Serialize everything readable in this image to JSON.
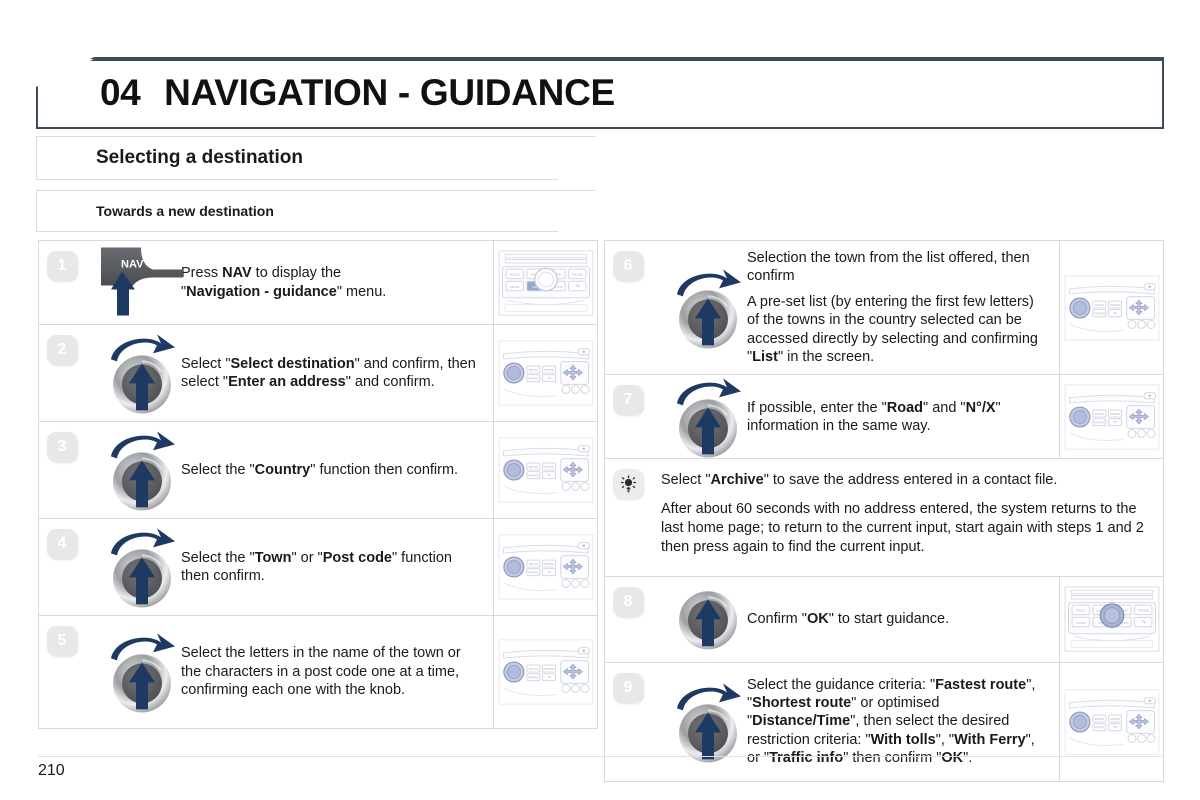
{
  "header": {
    "chapter_number": "04",
    "chapter_title": "NAVIGATION - GUIDANCE"
  },
  "section_title": "Selecting a destination",
  "subsection_title": "Towards a new destination",
  "page_number": "210",
  "colors": {
    "header_border": "#3c4a5a",
    "arrow_navy": "#1e3a63",
    "badge_grey": "#e8e8ea",
    "highlight_blue": "#9aa8cf",
    "knob_dark": "#5a5c5f"
  },
  "head_unit_buttons": {
    "top_row": [
      "RADIO",
      "MUSIC",
      "SETUP",
      "PHONE"
    ],
    "bottom_row": [
      "MODE",
      "NAV",
      "TRAFFIC"
    ],
    "side_labels": [
      "SETUP",
      "PHONE",
      "TRAFFIC"
    ]
  },
  "steps_left": [
    {
      "number": "1",
      "icon": "nav-button-press-icon",
      "screenshot": "head-unit-nav-highlighted",
      "text_html": "Press <b>NAV</b> to display the<br>\"<b>Navigation - guidance</b>\" menu."
    },
    {
      "number": "2",
      "icon": "rotary-knob-turn-press-icon",
      "screenshot": "head-unit-wide-knob",
      "text_html": "Select \"<b>Select destination</b>\" and confirm, then select \"<b>Enter an address</b>\" and confirm."
    },
    {
      "number": "3",
      "icon": "rotary-knob-turn-press-icon",
      "screenshot": "head-unit-wide-knob",
      "text_html": "Select the \"<b>Country</b>\" function then confirm."
    },
    {
      "number": "4",
      "icon": "rotary-knob-turn-press-icon",
      "screenshot": "head-unit-wide-knob",
      "text_html": "Select the \"<b>Town</b>\" or \"<b>Post code</b>\" function then confirm."
    },
    {
      "number": "5",
      "icon": "rotary-knob-turn-press-icon",
      "screenshot": "head-unit-wide-knob",
      "text_html": "Select the letters in the name of the town or the characters in a post code one at a time, confirming each one with the knob."
    }
  ],
  "steps_right": [
    {
      "number": "6",
      "icon": "rotary-knob-turn-press-icon",
      "screenshot": "head-unit-wide-knob",
      "paragraphs_html": [
        "Selection the town from the list offered, then confirm",
        "A pre-set list (by entering the first few letters) of the towns in the country selected can be accessed directly by selecting and confirming \"<b>List</b>\" in the screen."
      ]
    },
    {
      "number": "7",
      "icon": "rotary-knob-turn-press-icon",
      "screenshot": "head-unit-wide-knob",
      "paragraphs_html": [
        "If possible, enter the \"<b>Road</b>\" and \"<b>N°/X</b>\" information in the same way."
      ]
    }
  ],
  "tip": {
    "icon": "lightbulb-tip-icon",
    "paragraphs_html": [
      "Select \"<b>Archive</b>\" to save the address entered in a contact file.",
      "After about 60 seconds with no address entered, the system returns to the last home page; to return to the current input, start again with steps 1 and 2 then press again to find the current input."
    ]
  },
  "steps_right_lower": [
    {
      "number": "8",
      "icon": "rotary-knob-press-icon",
      "screenshot": "head-unit-centre-knob-highlighted",
      "paragraphs_html": [
        "Confirm \"<b>OK</b>\" to start guidance."
      ]
    },
    {
      "number": "9",
      "icon": "rotary-knob-turn-press-icon",
      "screenshot": "head-unit-wide-knob",
      "paragraphs_html": [
        "Select the guidance criteria: \"<b>Fastest route</b>\", \"<b>Shortest route</b>\" or optimised \"<b>Distance/Time</b>\", then select the desired restriction criteria: \"<b>With tolls</b>\", \"<b>With Ferry</b>\", or \"<b>Traffic info</b>\" then confirm \"<b>OK</b>\"."
      ]
    }
  ]
}
